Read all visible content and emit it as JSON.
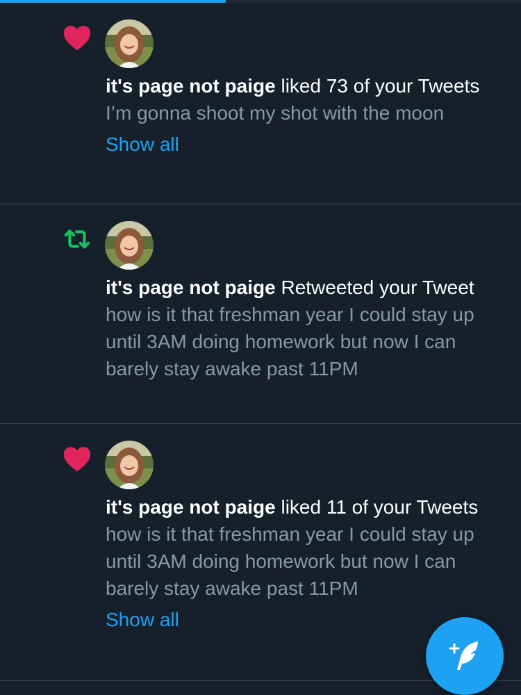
{
  "progress": {
    "fraction": 0.433
  },
  "notifications": [
    {
      "type": "like",
      "icon": "heart-icon",
      "user": "it's page not paige",
      "action": " liked 73 of your Tweets",
      "snippet": "I’m gonna shoot my shot with the moon",
      "show_all": "Show all"
    },
    {
      "type": "retweet",
      "icon": "retweet-icon",
      "user": "it's page not paige",
      "action": " Retweeted your Tweet",
      "snippet": "how is it that freshman year I could stay up until 3AM doing homework but now I can barely stay awake past 11PM"
    },
    {
      "type": "like",
      "icon": "heart-icon",
      "user": "it's page not paige",
      "action": " liked 11 of your Tweets",
      "snippet": "how is it that freshman year I could stay up until 3AM doing homework but now I can barely stay awake past 11PM",
      "show_all": "Show all"
    }
  ],
  "compose_button": {
    "icon": "compose-tweet-icon"
  },
  "colors": {
    "background": "#15202b",
    "divider": "#38444d",
    "heart": "#e0245e",
    "retweet": "#17bf63",
    "link": "#1da1f2",
    "secondary_text": "#8899a6"
  }
}
